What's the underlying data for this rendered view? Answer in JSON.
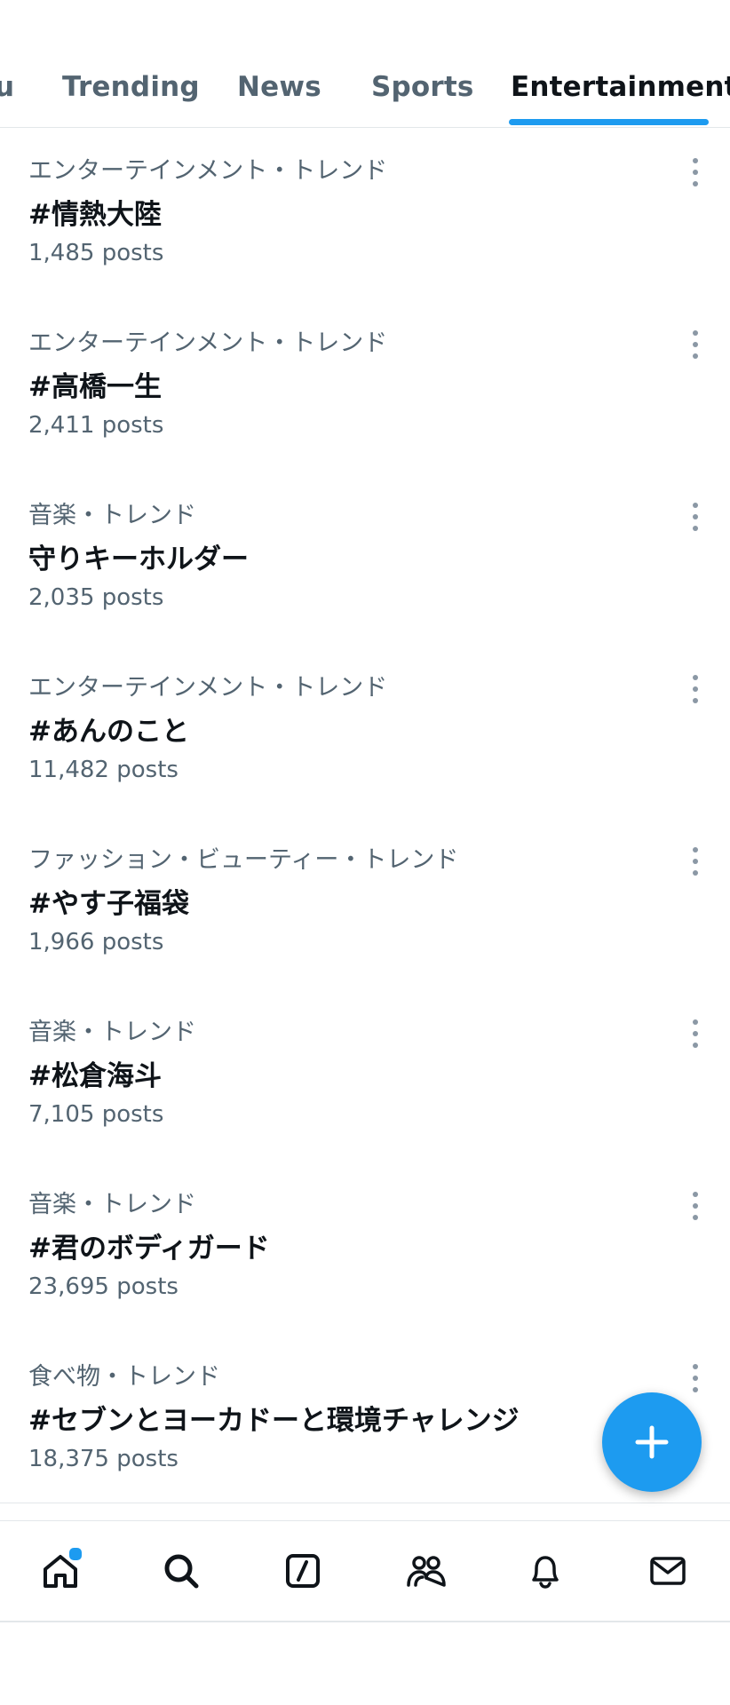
{
  "tabs": [
    {
      "label": "u"
    },
    {
      "label": "Trending"
    },
    {
      "label": "News"
    },
    {
      "label": "Sports"
    },
    {
      "label": "Entertainment",
      "active": true
    }
  ],
  "trends": [
    {
      "category": "エンターテインメント・トレンド",
      "name": "#情熱大陸",
      "count": "1,485 posts"
    },
    {
      "category": "エンターテインメント・トレンド",
      "name": "#高橋一生",
      "count": "2,411 posts"
    },
    {
      "category": "音楽・トレンド",
      "name": "守りキーホルダー",
      "count": "2,035 posts"
    },
    {
      "category": "エンターテインメント・トレンド",
      "name": "#あんのこと",
      "count": "11,482 posts"
    },
    {
      "category": "ファッション・ビューティー・トレンド",
      "name": "#やす子福袋",
      "count": "1,966 posts"
    },
    {
      "category": "音楽・トレンド",
      "name": "#松倉海斗",
      "count": "7,105 posts"
    },
    {
      "category": "音楽・トレンド",
      "name": "#君のボディガード",
      "count": "23,695 posts"
    },
    {
      "category": "食べ物・トレンド",
      "name": "#セブンとヨーカドーと環境チャレンジ",
      "count": "18,375 posts"
    }
  ],
  "icons": {
    "more": "more-vertical-icon",
    "compose": "plus-icon",
    "nav": [
      "home-icon",
      "search-icon",
      "grok-icon",
      "communities-icon",
      "bell-icon",
      "mail-icon"
    ]
  },
  "colors": {
    "accent": "#1d9bf0",
    "text": "#0f1419",
    "secondary": "#536471"
  }
}
